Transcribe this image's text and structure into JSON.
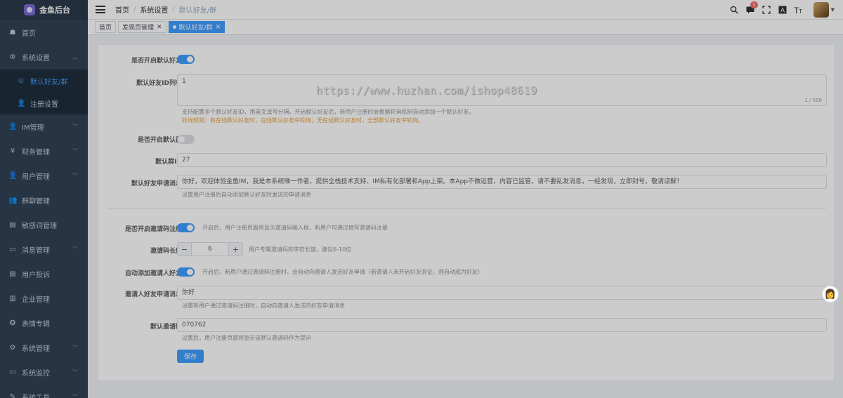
{
  "app": {
    "title": "金鱼后台"
  },
  "sidebar": {
    "items": [
      {
        "label": "首页",
        "icon": "dashboard-icon",
        "glyph": "☗"
      },
      {
        "label": "系统设置",
        "icon": "gear-icon",
        "glyph": "⚙",
        "expanded": true
      },
      {
        "label": "IM管理",
        "icon": "user-icon",
        "glyph": "👤"
      },
      {
        "label": "财务管理",
        "icon": "yen-icon",
        "glyph": "¥"
      },
      {
        "label": "用户管理",
        "icon": "user-icon",
        "glyph": "👤"
      },
      {
        "label": "群聊管理",
        "icon": "group-icon",
        "glyph": "👥"
      },
      {
        "label": "敏感词管理",
        "icon": "document-icon",
        "glyph": "▤"
      },
      {
        "label": "消息管理",
        "icon": "message-icon",
        "glyph": "▭"
      },
      {
        "label": "用户投诉",
        "icon": "document-icon",
        "glyph": "▤"
      },
      {
        "label": "企业管理",
        "icon": "building-icon",
        "glyph": "▥"
      },
      {
        "label": "表情专辑",
        "icon": "emoji-icon",
        "glyph": "✪"
      },
      {
        "label": "系统管理",
        "icon": "gear-icon",
        "glyph": "⚙"
      },
      {
        "label": "系统监控",
        "icon": "monitor-icon",
        "glyph": "▭"
      },
      {
        "label": "系统工具",
        "icon": "tool-icon",
        "glyph": "✎"
      }
    ],
    "submenu": [
      {
        "label": "默认好友/群",
        "active": true
      },
      {
        "label": "注册设置"
      }
    ]
  },
  "navbar": {
    "breadcrumb": [
      "首页",
      "系统设置",
      "默认好友/群"
    ],
    "badge_count": "1"
  },
  "tags": [
    {
      "label": "首页"
    },
    {
      "label": "发现页管理"
    },
    {
      "label": "默认好友/群",
      "active": true
    }
  ],
  "form": {
    "enable_default_friend": {
      "label": "是否开启默认好友",
      "on": true
    },
    "friend_ids": {
      "label": "默认好友ID列表",
      "value": "1",
      "counter": "1 / 500",
      "hint": "支持配置多个默认好友ID，用英文逗号分隔。开启默认好友后，新用户注册时会根据轮询机制自动添加一个默认好友。",
      "warn": "轮询规则：有在线默认好友时，在线默认好友中轮询；无在线默认好友时，全部默认好友中轮询。"
    },
    "enable_default_group": {
      "label": "是否开启默认群",
      "on": false
    },
    "group_id": {
      "label": "默认群ID",
      "value": "27"
    },
    "friend_request_msg": {
      "label": "默认好友申请消息",
      "value": "你好，欢迎体验金鱼IM，我是本系统唯一作者，提供全栈技术支持、IM私有化部署和App上架。本App不做运营，内容已监管，请不要乱发消息，一经发现，立即封号，敬请谅解！",
      "hint": "设置用户注册后自动添加默认好友时发送的申请消息"
    },
    "enable_invite_code": {
      "label": "是否开启邀请码注册",
      "on": true,
      "hint": "开启后，用户注册页面将显示邀请码输入框，新用户可通过填写邀请码注册"
    },
    "invite_code_length": {
      "label": "邀请码长度",
      "value": "6",
      "hint": "用户专属邀请码的字符长度，建议6-10位"
    },
    "auto_add_inviter": {
      "label": "自动添加邀请人好友",
      "on": true,
      "hint": "开启后，新用户通过邀请码注册时，会自动向邀请人发送好友申请（若邀请人未开启好友验证，则自动成为好友）"
    },
    "inviter_request_msg": {
      "label": "邀请人好友申请消息",
      "value": "你好",
      "hint": "设置新用户通过邀请码注册时，自动向邀请人发送的好友申请消息"
    },
    "default_invite_code": {
      "label": "默认邀请码",
      "value": "070762",
      "hint": "设置后，用户注册页面将显示该默认邀请码作为提示"
    },
    "save_label": "保存"
  },
  "watermark": "https://www.huzhan.com/ishop48619"
}
